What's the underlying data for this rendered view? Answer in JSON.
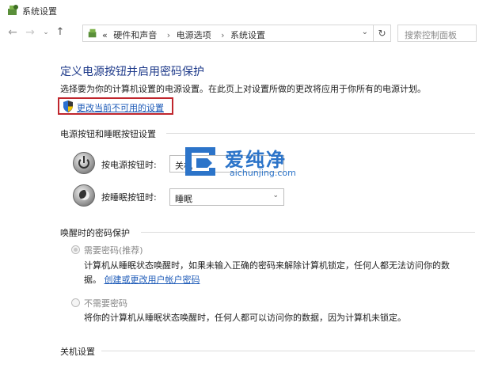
{
  "window": {
    "title": "系统设置"
  },
  "nav": {
    "back_glyph": "←",
    "forward_glyph": "→",
    "recent_glyph": "⌄",
    "up_glyph": "↑",
    "breadcrumb_prefix": "«",
    "breadcrumbs": [
      "硬件和声音",
      "电源选项",
      "系统设置"
    ],
    "crumb_sep": "›",
    "dropdown_glyph": "⌄",
    "refresh_glyph": "↻",
    "search_placeholder": "搜索控制面板"
  },
  "page": {
    "title": "定义电源按钮并启用密码保护",
    "description": "选择要为你的计算机设置的电源设置。在此页上对设置所做的更改将应用于你所有的电源计划。",
    "change_link": "更改当前不可用的设置"
  },
  "power_section": {
    "title": "电源按钮和睡眠按钮设置",
    "power_label": "按电源按钮时:",
    "power_value": "关机",
    "sleep_label": "按睡眠按钮时:",
    "sleep_value": "睡眠",
    "arrow_glyph": "⌄"
  },
  "password_section": {
    "title": "唤醒时的密码保护",
    "option1_label": "需要密码(推荐)",
    "option1_desc_line1": "计算机从睡眠状态唤醒时，如果未输入正确的密码来解除计算机锁定，任何人都无法访问你的数",
    "option1_desc_line2_prefix": "据。",
    "option1_link": "创建或更改用户帐户密码",
    "option2_label": "不需要密码",
    "option2_desc": "将你的计算机从睡眠状态唤醒时，任何人都可以访问你的数据，因为计算机未锁定。"
  },
  "shutdown_section": {
    "title": "关机设置"
  },
  "watermark": {
    "name": "爱纯净",
    "url": "aichunjing.com"
  },
  "colors": {
    "accent": "#1e5bb8",
    "title": "#1e3a8a",
    "highlight_border": "#c0262d",
    "watermark": "#2c74c9"
  },
  "icons": [
    "control-panel-icon",
    "shield-icon",
    "power-button-icon",
    "sleep-button-icon",
    "watermark-logo-icon"
  ]
}
